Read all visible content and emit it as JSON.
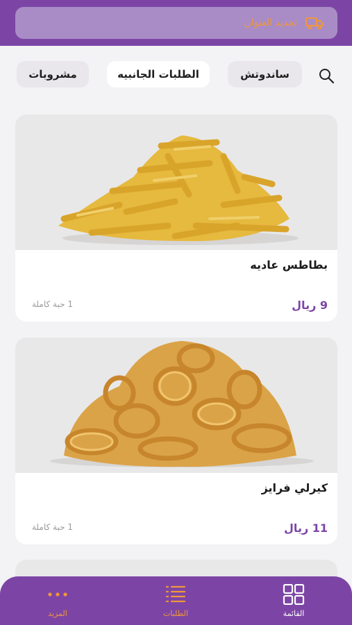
{
  "header": {
    "address_label": "تحديد العنوان",
    "icon": "delivery-truck-icon"
  },
  "categories": {
    "search_icon": "search-icon",
    "items": [
      {
        "label": "ساندوتش",
        "selected": false
      },
      {
        "label": "الطلبات الجانبيه",
        "selected": true
      },
      {
        "label": "مشروبات",
        "selected": false
      }
    ]
  },
  "products": [
    {
      "name": "بطاطس عاديه",
      "price": "9 ريال",
      "quantity": "1 حبة كاملة"
    },
    {
      "name": "كيرلي فرايز",
      "price": "11 ريال",
      "quantity": "1 حبة كاملة"
    }
  ],
  "bottom_nav": {
    "items": [
      {
        "label": "القائمة",
        "icon": "grid-icon",
        "active": true
      },
      {
        "label": "الطلبات",
        "icon": "list-icon",
        "active": false
      },
      {
        "label": "المزيد",
        "icon": "more-dots-icon",
        "active": false
      }
    ]
  },
  "colors": {
    "brand_purple": "#7c45a5",
    "accent_orange": "#f0973c",
    "price_purple": "#7c45a5"
  }
}
